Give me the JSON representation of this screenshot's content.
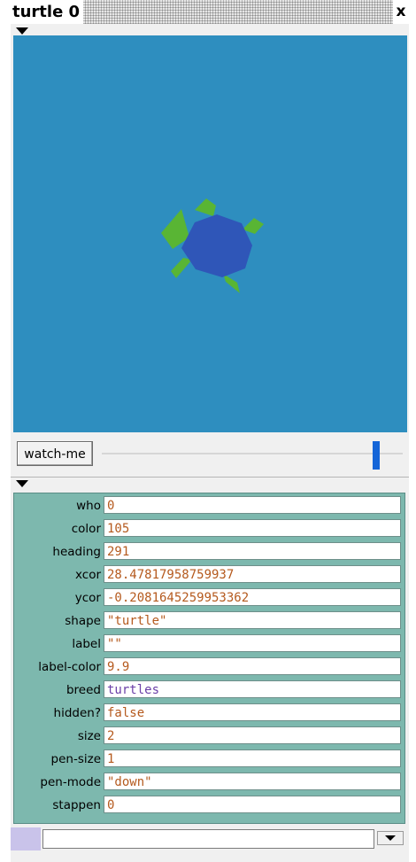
{
  "window": {
    "title": "turtle 0",
    "close_glyph": "x"
  },
  "view": {
    "background_color": "#2e8ebf",
    "turtle_shape_icon": "turtle-icon",
    "turtle_shell_color": "#2f56b8",
    "turtle_limb_color": "#59b534"
  },
  "watch": {
    "button_label": "watch-me",
    "slider_color": "#1565d8"
  },
  "inspector": {
    "background_color": "#7db8ae",
    "rows": [
      {
        "label": "who",
        "value": "0"
      },
      {
        "label": "color",
        "value": "105"
      },
      {
        "label": "heading",
        "value": "291"
      },
      {
        "label": "xcor",
        "value": "28.47817958759937"
      },
      {
        "label": "ycor",
        "value": "-0.2081645259953362"
      },
      {
        "label": "shape",
        "value": "\"turtle\""
      },
      {
        "label": "label",
        "value": "\"\""
      },
      {
        "label": "label-color",
        "value": "9.9"
      },
      {
        "label": "breed",
        "value": "turtles"
      },
      {
        "label": "hidden?",
        "value": "false"
      },
      {
        "label": "size",
        "value": "2"
      },
      {
        "label": "pen-size",
        "value": "1"
      },
      {
        "label": "pen-mode",
        "value": "\"down\""
      },
      {
        "label": "stappen",
        "value": "0"
      }
    ]
  },
  "command": {
    "input_value": "",
    "dropdown_icon": "chevron-down-icon"
  }
}
